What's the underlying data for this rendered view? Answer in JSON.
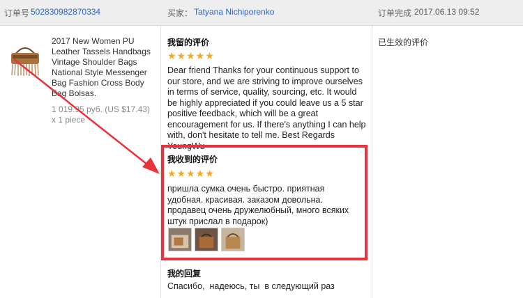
{
  "header": {
    "order_label": "订单号",
    "order_number": "502830982870334",
    "buyer_label": "买家：",
    "buyer_name": "Tatyana Nichiporenko",
    "complete_label": "订单完成",
    "complete_date": "2017.06.13 09:52"
  },
  "product": {
    "title": "2017 New Women PU Leather Tassels Handbags Vintage Shoulder Bags National Style Messenger Bag Fashion Cross Body Bag Bolsas.",
    "price": "1 019.95 руб. (US $17.43)",
    "quantity": "x 1 piece"
  },
  "seller_feedback": {
    "title": "我留的评价",
    "stars": "★★★★★",
    "rating": 5,
    "text": "Dear friend Thanks for your continuous support to our store, and we are striving to improve ourselves in terms of service, quality, sourcing, etc. It would be highly appreciated if you could leave us a 5 star positive feedback, which will be a great encouragement for us. If there's anything I can help with, don't hesitate to tell me. Best Regards YoungWu"
  },
  "received_feedback": {
    "title": "我收到的评价",
    "stars": "★★★★★",
    "rating": 5,
    "text": "пришла сумка очень быстро. приятная удобная. красивая. заказом довольна. продавец очень дружелюбный, много всяких штук прислал в подарок)"
  },
  "reply": {
    "title": "我的回复",
    "text": "Спасибо,  надеюсь, ты  в следующий раз"
  },
  "status": {
    "text": "已生效的评价"
  },
  "colors": {
    "highlight": "#e8323c",
    "link": "#2b64c6",
    "stars": "#f5a623",
    "header_bg": "#eeeeee"
  }
}
